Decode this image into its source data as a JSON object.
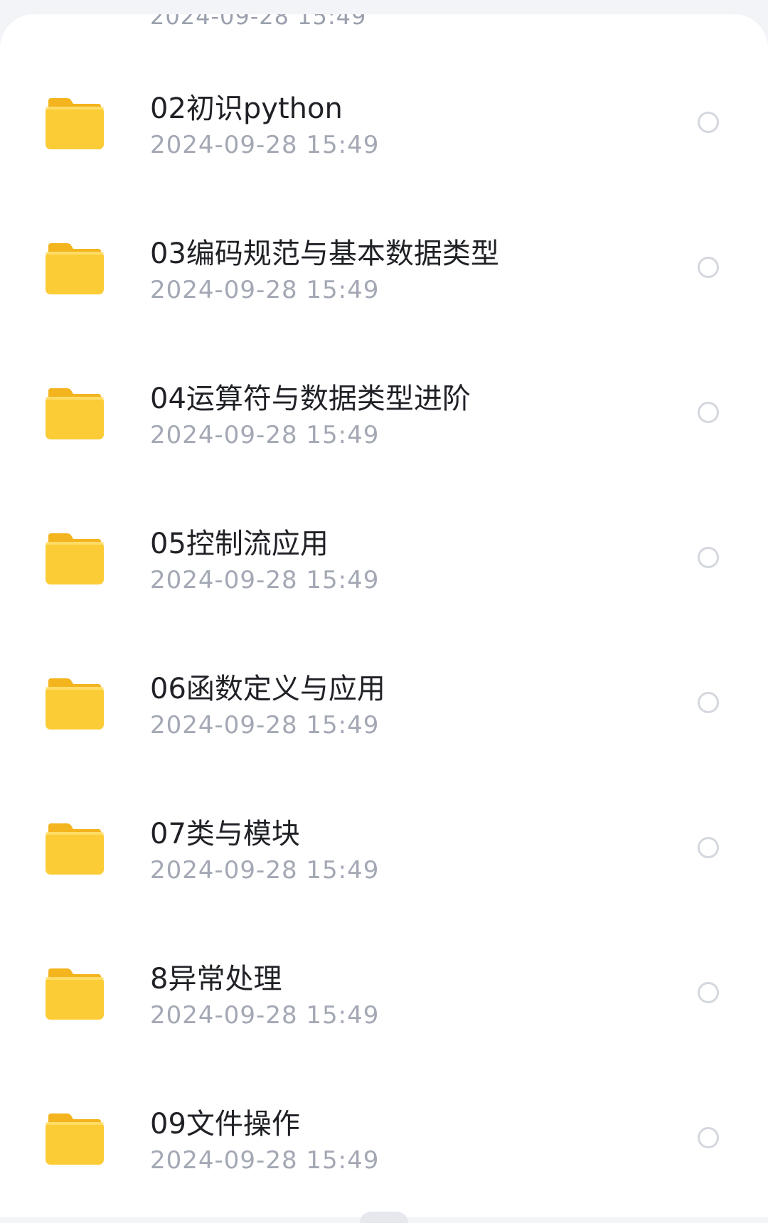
{
  "partial_item": {
    "date": "2024-09-28 15:49"
  },
  "files": [
    {
      "name": "02初识python",
      "date": "2024-09-28  15:49",
      "icon": "folder-icon"
    },
    {
      "name": "03编码规范与基本数据类型",
      "date": "2024-09-28  15:49",
      "icon": "folder-icon"
    },
    {
      "name": "04运算符与数据类型进阶",
      "date": "2024-09-28  15:49",
      "icon": "folder-icon"
    },
    {
      "name": "05控制流应用",
      "date": "2024-09-28  15:49",
      "icon": "folder-icon"
    },
    {
      "name": "06函数定义与应用",
      "date": "2024-09-28  15:49",
      "icon": "folder-icon"
    },
    {
      "name": "07类与模块",
      "date": "2024-09-28  15:49",
      "icon": "folder-icon"
    },
    {
      "name": "8异常处理",
      "date": "2024-09-28  15:49",
      "icon": "folder-icon"
    },
    {
      "name": "09文件操作",
      "date": "2024-09-28  15:49",
      "icon": "folder-icon"
    }
  ],
  "colors": {
    "folder": "#fbcc36",
    "folder_tab": "#f3b41d",
    "name_text": "#1f2126",
    "date_text": "#a3a8b4",
    "radio_border": "#d4d7de"
  }
}
